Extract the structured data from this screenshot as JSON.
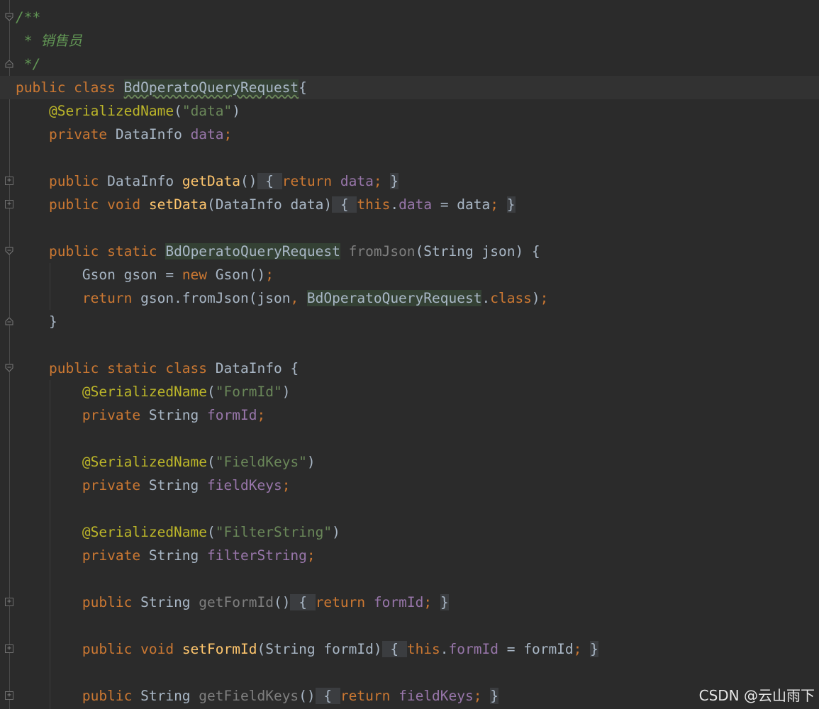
{
  "editor": {
    "lines": [
      {
        "y": 0,
        "tokens": [
          [
            "cmt",
            "/**"
          ]
        ]
      },
      {
        "y": 1,
        "tokens": [
          [
            "cmt",
            " * 销售员"
          ]
        ]
      },
      {
        "y": 2,
        "tokens": [
          [
            "cmt",
            " */"
          ]
        ]
      },
      {
        "y": 3,
        "current": true,
        "tokens": [
          [
            "kw",
            "public class "
          ],
          [
            "hl typo",
            "BdOperatoQueryRequest"
          ],
          [
            "",
            "{"
          ]
        ]
      },
      {
        "y": 4,
        "tokens": [
          [
            "",
            "    "
          ],
          [
            "ann",
            "@SerializedName"
          ],
          [
            "",
            "("
          ],
          [
            "str",
            "\"data\""
          ],
          [
            "",
            ")"
          ]
        ]
      },
      {
        "y": 5,
        "tokens": [
          [
            "",
            "    "
          ],
          [
            "kw",
            "private "
          ],
          [
            "",
            "DataInfo "
          ],
          [
            "fld",
            "data"
          ],
          [
            "kw",
            ";"
          ]
        ]
      },
      {
        "y": 7,
        "tokens": [
          [
            "",
            "    "
          ],
          [
            "kw",
            "public "
          ],
          [
            "",
            "DataInfo "
          ],
          [
            "mth",
            "getData"
          ],
          [
            "",
            "()"
          ],
          [
            "fb",
            " { "
          ],
          [
            "kw",
            "return "
          ],
          [
            "fld",
            "data"
          ],
          [
            "kw",
            "; "
          ],
          [
            "fb",
            "}"
          ]
        ]
      },
      {
        "y": 8,
        "tokens": [
          [
            "",
            "    "
          ],
          [
            "kw",
            "public void "
          ],
          [
            "mth",
            "setData"
          ],
          [
            "",
            "(DataInfo data)"
          ],
          [
            "fb",
            " { "
          ],
          [
            "kw",
            "this"
          ],
          [
            "",
            "."
          ],
          [
            "fld",
            "data"
          ],
          [
            "",
            " = data"
          ],
          [
            "kw",
            "; "
          ],
          [
            "fb",
            "}"
          ]
        ]
      },
      {
        "y": 10,
        "tokens": [
          [
            "",
            "    "
          ],
          [
            "kw",
            "public static "
          ],
          [
            "hl",
            "BdOperatoQueryRequest"
          ],
          [
            "unused",
            " fromJson"
          ],
          [
            "",
            "(String json) {"
          ]
        ]
      },
      {
        "y": 11,
        "tokens": [
          [
            "",
            "        Gson gson = "
          ],
          [
            "kw",
            "new "
          ],
          [
            "",
            "Gson()"
          ],
          [
            "kw",
            ";"
          ]
        ]
      },
      {
        "y": 12,
        "tokens": [
          [
            "",
            "        "
          ],
          [
            "kw",
            "return "
          ],
          [
            "",
            "gson.fromJson(json"
          ],
          [
            "kw",
            ", "
          ],
          [
            "hl",
            "BdOperatoQueryRequest"
          ],
          [
            "",
            "."
          ],
          [
            "kw",
            "class"
          ],
          [
            "",
            ")"
          ],
          [
            "kw",
            ";"
          ]
        ]
      },
      {
        "y": 13,
        "tokens": [
          [
            "",
            "    }"
          ]
        ]
      },
      {
        "y": 15,
        "tokens": [
          [
            "",
            "    "
          ],
          [
            "kw",
            "public static class "
          ],
          [
            "",
            "DataInfo {"
          ]
        ]
      },
      {
        "y": 16,
        "tokens": [
          [
            "",
            "        "
          ],
          [
            "ann",
            "@SerializedName"
          ],
          [
            "",
            "("
          ],
          [
            "str",
            "\"FormId\""
          ],
          [
            "",
            ")"
          ]
        ]
      },
      {
        "y": 17,
        "tokens": [
          [
            "",
            "        "
          ],
          [
            "kw",
            "private "
          ],
          [
            "",
            "String "
          ],
          [
            "fld",
            "formId"
          ],
          [
            "kw",
            ";"
          ]
        ]
      },
      {
        "y": 19,
        "tokens": [
          [
            "",
            "        "
          ],
          [
            "ann",
            "@SerializedName"
          ],
          [
            "",
            "("
          ],
          [
            "str",
            "\"FieldKeys\""
          ],
          [
            "",
            ")"
          ]
        ]
      },
      {
        "y": 20,
        "tokens": [
          [
            "",
            "        "
          ],
          [
            "kw",
            "private "
          ],
          [
            "",
            "String "
          ],
          [
            "fld",
            "fieldKeys"
          ],
          [
            "kw",
            ";"
          ]
        ]
      },
      {
        "y": 22,
        "tokens": [
          [
            "",
            "        "
          ],
          [
            "ann",
            "@SerializedName"
          ],
          [
            "",
            "("
          ],
          [
            "str",
            "\"FilterString\""
          ],
          [
            "",
            ")"
          ]
        ]
      },
      {
        "y": 23,
        "tokens": [
          [
            "",
            "        "
          ],
          [
            "kw",
            "private "
          ],
          [
            "",
            "String "
          ],
          [
            "fld",
            "filterString"
          ],
          [
            "kw",
            ";"
          ]
        ]
      },
      {
        "y": 25,
        "tokens": [
          [
            "",
            "        "
          ],
          [
            "kw",
            "public "
          ],
          [
            "",
            "String "
          ],
          [
            "unused",
            "getFormId"
          ],
          [
            "",
            "()"
          ],
          [
            "fb",
            " { "
          ],
          [
            "kw",
            "return "
          ],
          [
            "fld",
            "formId"
          ],
          [
            "kw",
            "; "
          ],
          [
            "fb",
            "}"
          ]
        ]
      },
      {
        "y": 27,
        "tokens": [
          [
            "",
            "        "
          ],
          [
            "kw",
            "public void "
          ],
          [
            "mth",
            "setFormId"
          ],
          [
            "",
            "(String formId)"
          ],
          [
            "fb",
            " { "
          ],
          [
            "kw",
            "this"
          ],
          [
            "",
            "."
          ],
          [
            "fld",
            "formId"
          ],
          [
            "",
            " = formId"
          ],
          [
            "kw",
            "; "
          ],
          [
            "fb",
            "}"
          ]
        ]
      },
      {
        "y": 29,
        "tokens": [
          [
            "",
            "        "
          ],
          [
            "kw",
            "public "
          ],
          [
            "",
            "String "
          ],
          [
            "unused",
            "getFieldKeys"
          ],
          [
            "",
            "()"
          ],
          [
            "fb",
            " { "
          ],
          [
            "kw",
            "return "
          ],
          [
            "fld",
            "fieldKeys"
          ],
          [
            "kw",
            "; "
          ],
          [
            "fb",
            "}"
          ]
        ]
      }
    ],
    "folds": [
      {
        "y": 0,
        "kind": "down"
      },
      {
        "y": 2,
        "kind": "up"
      },
      {
        "y": 7,
        "kind": "box"
      },
      {
        "y": 8,
        "kind": "box"
      },
      {
        "y": 10,
        "kind": "down"
      },
      {
        "y": 13,
        "kind": "up"
      },
      {
        "y": 15,
        "kind": "down"
      },
      {
        "y": 25,
        "kind": "box"
      },
      {
        "y": 27,
        "kind": "box"
      },
      {
        "y": 29,
        "kind": "box"
      }
    ]
  },
  "watermark": "CSDN @云山雨下",
  "colors": {
    "background": "#2b2b2b",
    "keyword": "#cc7832",
    "string": "#6a8759",
    "annotation": "#bbb529",
    "field": "#9876aa",
    "method": "#ffc66d",
    "comment": "#629755"
  }
}
